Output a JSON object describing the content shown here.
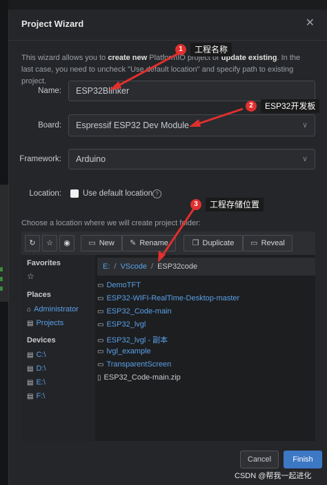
{
  "dialog": {
    "title": "Project Wizard",
    "close_glyph": "✕",
    "intro_prefix": "This wizard allows you to ",
    "intro_bold1": "create new",
    "intro_mid": " PlatformIO project or ",
    "intro_bold2": "update existing",
    "intro_suffix": ". In the last case, you need to uncheck \"Use default location\" and specify path to existing project."
  },
  "form": {
    "name_label": "Name:",
    "name_value": "ESP32Blinker",
    "board_label": "Board:",
    "board_value": "Espressif ESP32 Dev Module",
    "framework_label": "Framework:",
    "framework_value": "Arduino",
    "location_label": "Location:",
    "use_default_label": "Use default location",
    "help_glyph": "?",
    "choose_text": "Choose a location where we will create project folder:"
  },
  "toolbar": {
    "refresh_glyph": "↻",
    "star_glyph": "☆",
    "eye_glyph": "◉",
    "new_label": "New",
    "rename_label": "Rename",
    "duplicate_label": "Duplicate",
    "reveal_label": "Reveal",
    "icons": {
      "new": "folder-icon",
      "rename": "pencil-icon",
      "duplicate": "copy-icon",
      "reveal": "folder-open-icon"
    }
  },
  "sidebar": {
    "favorites_heading": "Favorites",
    "favorite_star": "☆",
    "places_heading": "Places",
    "places": [
      "Administrator",
      "Projects"
    ],
    "devices_heading": "Devices",
    "devices": [
      "C:\\",
      "D:\\",
      "E:\\",
      "F:\\"
    ]
  },
  "path": {
    "segments": [
      "E:",
      "VScode",
      "ESP32code"
    ],
    "separator": "/"
  },
  "files": [
    {
      "name": "DemoTFT",
      "type": "folder"
    },
    {
      "name": "ESP32-WIFI-RealTime-Desktop-master",
      "type": "folder"
    },
    {
      "name": "ESP32_Code-main",
      "type": "folder"
    },
    {
      "name": "ESP32_lvgl",
      "type": "folder"
    },
    {
      "name": "ESP32_lvgl - 副本",
      "type": "folder"
    },
    {
      "name": "lvgl_example",
      "type": "folder"
    },
    {
      "name": "TransparentScreen",
      "type": "folder"
    },
    {
      "name": "ESP32_Code-main.zip",
      "type": "file"
    }
  ],
  "footer": {
    "cancel_label": "Cancel",
    "finish_label": "Finish",
    "watermark": "CSDN @帮我一起进化"
  },
  "annotations": [
    {
      "number": "1",
      "label": "工程名称"
    },
    {
      "number": "2",
      "label": "ESP32开发板"
    },
    {
      "number": "3",
      "label": "工程存储位置"
    }
  ],
  "colors": {
    "background": "#252629",
    "link": "#5aa0e8",
    "accent_button": "#3c78c4",
    "annotation_red": "#e0302e"
  }
}
